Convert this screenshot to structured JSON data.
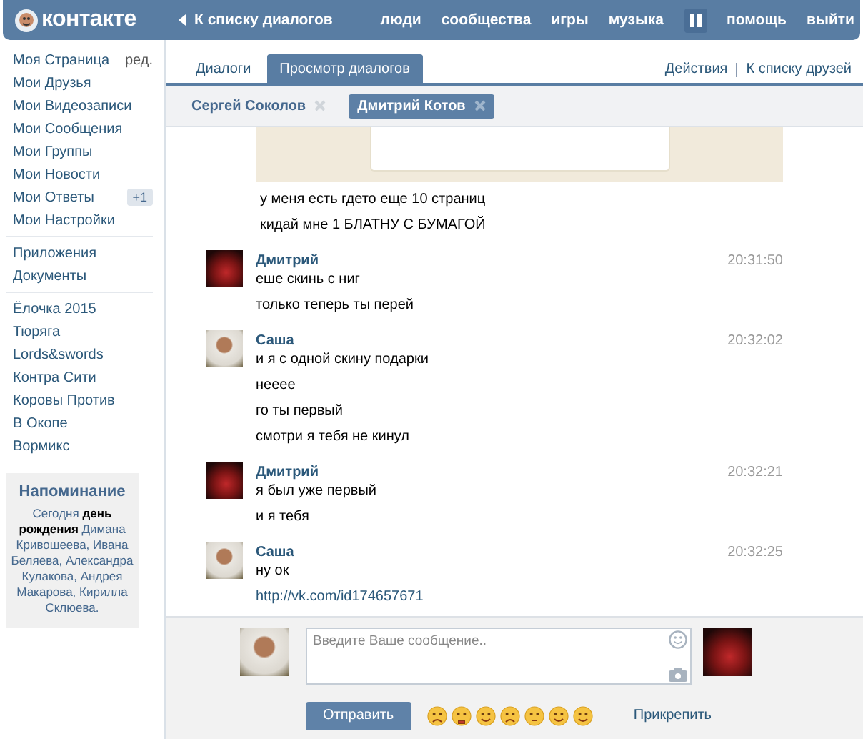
{
  "header": {
    "logo": "контакте",
    "back_link": "К списку диалогов",
    "nav": [
      {
        "kind": "link",
        "label": "люди"
      },
      {
        "kind": "link",
        "label": "сообщества"
      },
      {
        "kind": "link",
        "label": "игры"
      },
      {
        "kind": "link",
        "label": "музыка"
      },
      {
        "kind": "player",
        "playing": true
      },
      {
        "kind": "link",
        "label": "помощь"
      },
      {
        "kind": "link",
        "label": "выйти"
      }
    ]
  },
  "sidebar": {
    "sections": [
      {
        "items": [
          {
            "label": "Моя Страница",
            "extra": "ред."
          },
          {
            "label": "Мои Друзья"
          },
          {
            "label": "Мои Видеозаписи"
          },
          {
            "label": "Мои Сообщения"
          },
          {
            "label": "Мои Группы"
          },
          {
            "label": "Мои Новости"
          },
          {
            "label": "Мои Ответы",
            "badge": "+1"
          },
          {
            "label": "Мои Настройки"
          }
        ]
      },
      {
        "items": [
          {
            "label": "Приложения"
          },
          {
            "label": "Документы"
          }
        ]
      },
      {
        "items": [
          {
            "label": "Ёлочка 2015"
          },
          {
            "label": "Тюряга"
          },
          {
            "label": "Lords&swords"
          },
          {
            "label": "Контра Сити"
          },
          {
            "label": "Коровы Против"
          },
          {
            "label": "В Окопе"
          },
          {
            "label": "Вормикс"
          }
        ]
      }
    ],
    "reminder": {
      "title": "Напоминание",
      "text": "Сегодня **день рождения** Димана Кривошеева, Ивана Беляева, Александра Кулакова, Андрея Макарова, Кирилла Склюева."
    }
  },
  "tabs": [
    {
      "label": "Диалоги",
      "selected": false
    },
    {
      "label": "Просмотр диалогов",
      "selected": true
    }
  ],
  "actions": [
    "Действия",
    "К списку друзей"
  ],
  "participants": [
    {
      "name": "Сергей Соколов",
      "selected": false
    },
    {
      "name": "Дмитрий Котов",
      "selected": true
    }
  ],
  "messages": [
    {
      "kind": "continuation",
      "texts": [
        {
          "kind": "text",
          "text": "у меня есть гдето еще 10 страниц"
        },
        {
          "kind": "text",
          "text": "кидай мне 1 БЛАТНУ С БУМАГОЙ"
        }
      ]
    },
    {
      "kind": "dark",
      "author": "Дмитрий",
      "time": "20:31:50",
      "texts": [
        {
          "kind": "text",
          "text": "еше скинь с ниг"
        },
        {
          "kind": "text",
          "text": "только теперь ты перей"
        }
      ]
    },
    {
      "kind": "light",
      "author": "Саша",
      "time": "20:32:02",
      "texts": [
        {
          "kind": "text",
          "text": "и я с одной скину подарки"
        },
        {
          "kind": "text",
          "text": "нееее"
        },
        {
          "kind": "text",
          "text": "го ты первый"
        },
        {
          "kind": "text",
          "text": "смотри я тебя не кинул"
        }
      ]
    },
    {
      "kind": "dark",
      "author": "Дмитрий",
      "time": "20:32:21",
      "texts": [
        {
          "kind": "text",
          "text": "я был уже первый"
        },
        {
          "kind": "text",
          "text": "и я тебя"
        }
      ]
    },
    {
      "kind": "light",
      "author": "Саша",
      "time": "20:32:25",
      "texts": [
        {
          "kind": "text",
          "text": "ну ок"
        },
        {
          "kind": "link",
          "text": "http://vk.com/id174657671"
        }
      ]
    }
  ],
  "composer": {
    "placeholder": "Введите Ваше сообщение..",
    "send": "Отправить",
    "attach": "Прикрепить"
  }
}
